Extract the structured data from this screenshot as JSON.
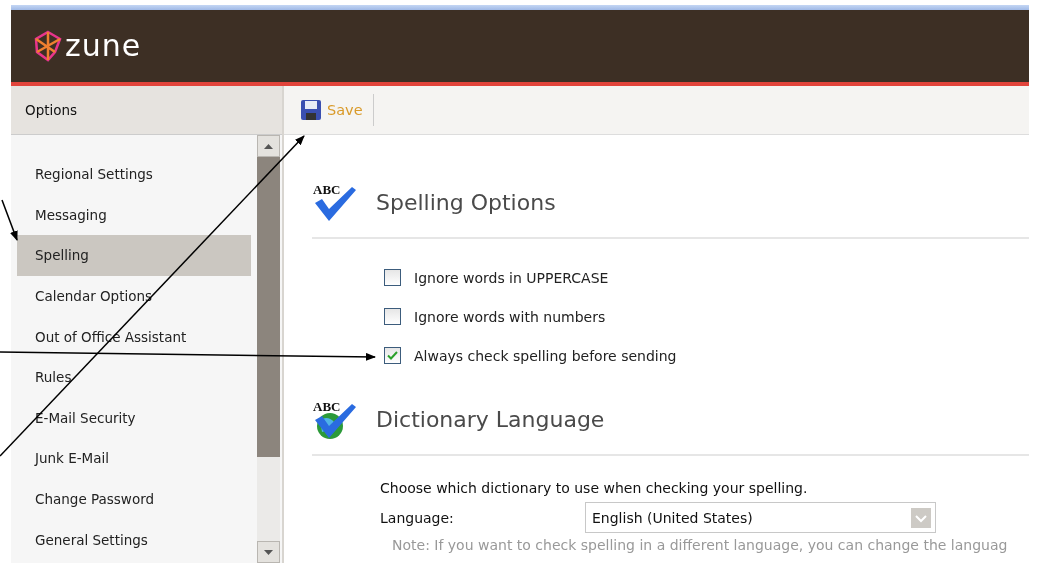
{
  "header": {
    "logo_text": "zune"
  },
  "sidebar": {
    "title": "Options",
    "items": [
      {
        "label": "Regional Settings",
        "selected": false
      },
      {
        "label": "Messaging",
        "selected": false
      },
      {
        "label": "Spelling",
        "selected": true
      },
      {
        "label": "Calendar Options",
        "selected": false
      },
      {
        "label": "Out of Office Assistant",
        "selected": false
      },
      {
        "label": "Rules",
        "selected": false
      },
      {
        "label": "E-Mail Security",
        "selected": false
      },
      {
        "label": "Junk E-Mail",
        "selected": false
      },
      {
        "label": "Change Password",
        "selected": false
      },
      {
        "label": "General Settings",
        "selected": false
      }
    ]
  },
  "toolbar": {
    "buttons": [
      "Save"
    ]
  },
  "sections": [
    {
      "kind": "checks",
      "title": "Spelling Options",
      "icon_text": "ABC",
      "options": [
        {
          "label": "Ignore words in UPPERCASE",
          "checked": false
        },
        {
          "label": "Ignore words with numbers",
          "checked": false
        },
        {
          "label": "Always check spelling before sending",
          "checked": true
        }
      ]
    },
    {
      "kind": "language",
      "title": "Dictionary Language",
      "icon_text": "ABC",
      "intro": "Choose which dictionary to use when checking your spelling.",
      "field_label": "Language:",
      "value": "English (United States)",
      "note": "Note: If you want to check spelling in a different language, you can change the languag"
    }
  ]
}
